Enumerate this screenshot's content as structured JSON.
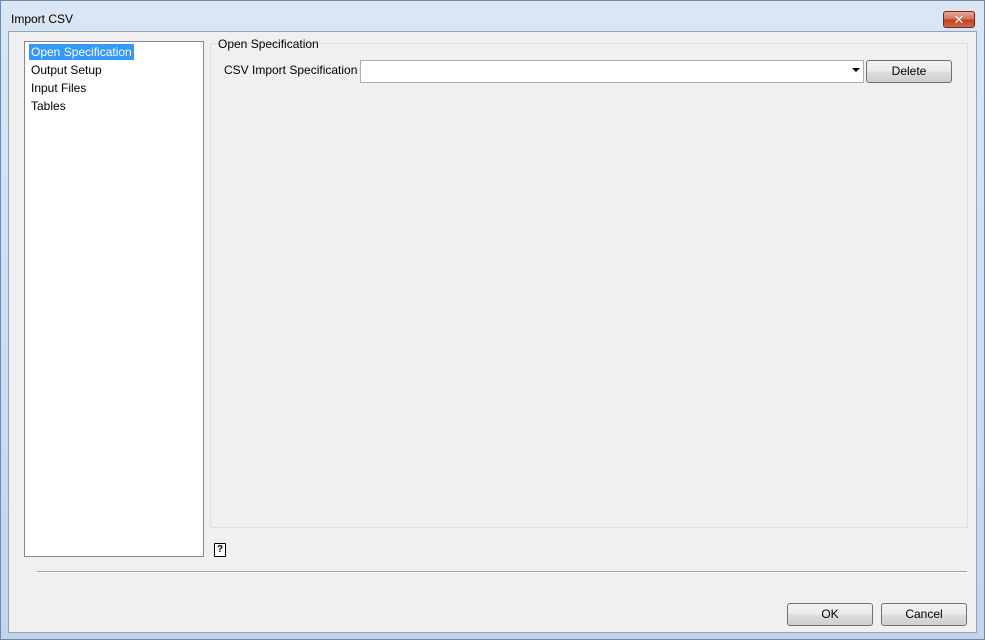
{
  "window": {
    "title": "Import CSV",
    "close_label": "✕"
  },
  "nav": {
    "items": [
      {
        "label": "Open Specification",
        "selected": true
      },
      {
        "label": "Output Setup",
        "selected": false
      },
      {
        "label": "Input Files",
        "selected": false
      },
      {
        "label": "Tables",
        "selected": false
      }
    ]
  },
  "panel": {
    "group_title": "Open Specification",
    "spec_label": "CSV Import Specification",
    "spec_value": "",
    "delete_label": "Delete"
  },
  "footer": {
    "help_glyph": "?",
    "ok_label": "OK",
    "cancel_label": "Cancel"
  },
  "colors": {
    "selection": "#3399ff",
    "dialog_bg": "#f0f0f0",
    "title_bg": "#c4d5ea"
  }
}
